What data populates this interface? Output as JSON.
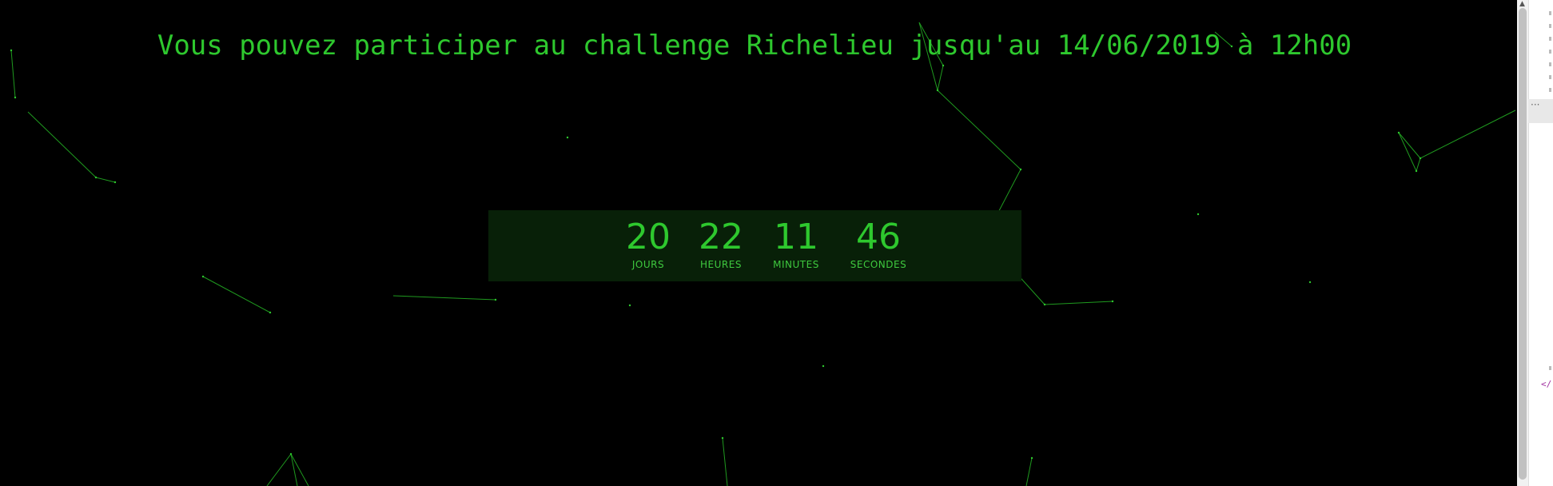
{
  "headline": "Vous pouvez participer au challenge Richelieu jusqu'au 14/06/2019 à 12h00",
  "countdown": {
    "days": {
      "value": "20",
      "label": "JOURS"
    },
    "hours": {
      "value": "22",
      "label": "HEURES"
    },
    "minutes": {
      "value": "11",
      "label": "MINUTES"
    },
    "seconds": {
      "value": "46",
      "label": "SECONDES"
    }
  },
  "devtools": {
    "more_glyph": "···",
    "close_tag": "</"
  },
  "colors": {
    "background": "#000000",
    "accent_green": "#2ec82e",
    "countdown_panel": "#082008"
  }
}
